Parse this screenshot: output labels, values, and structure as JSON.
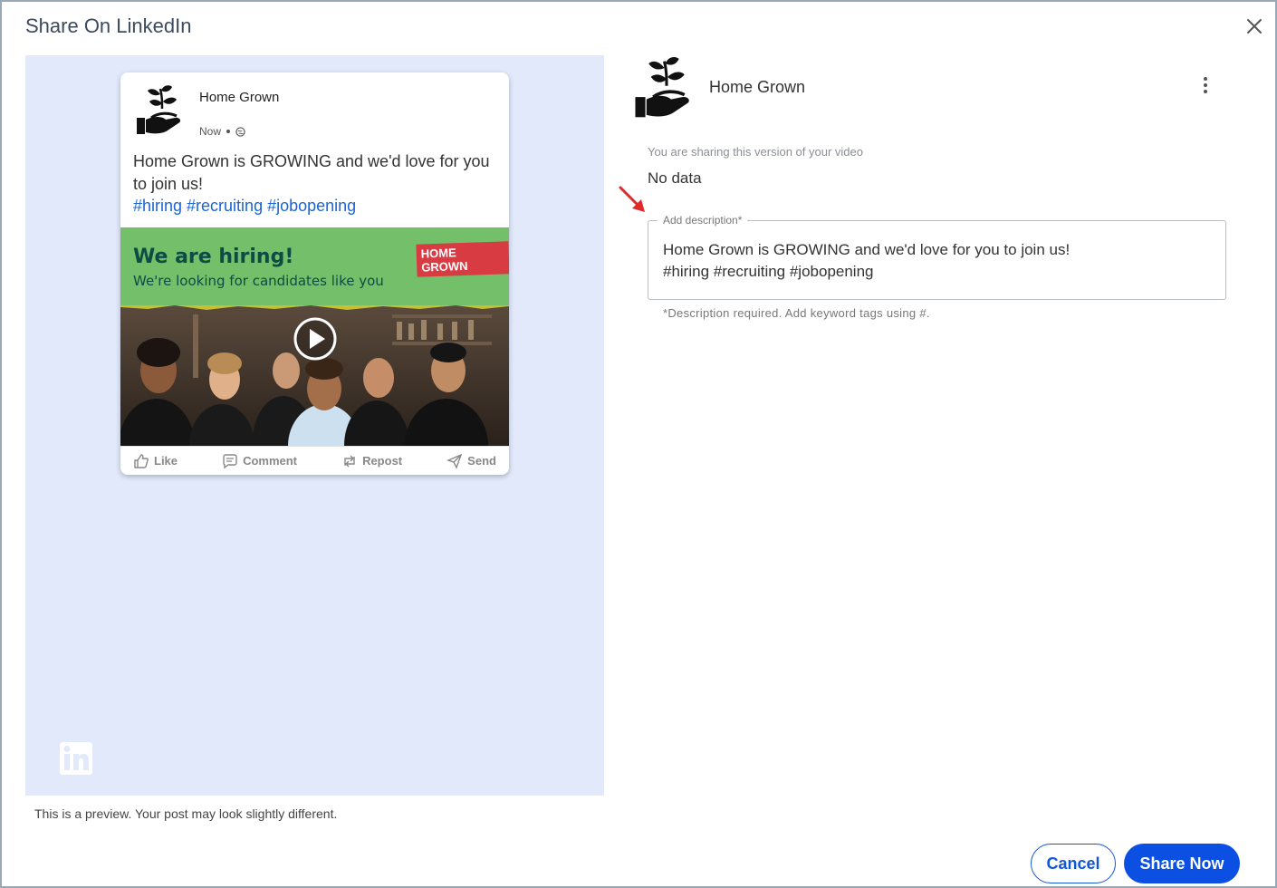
{
  "dialog": {
    "title": "Share On LinkedIn",
    "close_icon": "close-icon"
  },
  "preview": {
    "post": {
      "author": "Home Grown",
      "time": "Now",
      "visibility_icon": "globe-icon",
      "text": "Home Grown is GROWING and we'd love for you to join us!",
      "hashtags": "#hiring #recruiting #jobopening",
      "banner_title": "We are hiring!",
      "banner_subtitle": "We're looking for candidates like you",
      "banner_brand": "HOME GROWN",
      "actions": [
        "Like",
        "Comment",
        "Repost",
        "Send"
      ]
    },
    "note": "This is a preview. Your post may look slightly different.",
    "colors": {
      "pane_bg": "#e1e9fb",
      "banner_bg": "#74bf69",
      "hashtag": "#1a64d6"
    }
  },
  "profile": {
    "name": "Home Grown",
    "menu_icon": "more-vertical-icon"
  },
  "version": {
    "label": "You are sharing this version of your video",
    "value": "No data"
  },
  "description": {
    "label": "Add description*",
    "value": "Home Grown is GROWING and we'd love for you to join us!\n#hiring #recruiting #jobopening",
    "helper": "*Description required. Add keyword tags using #."
  },
  "footer": {
    "cancel_label": "Cancel",
    "share_label": "Share Now",
    "accent": "#0b4fe3"
  }
}
